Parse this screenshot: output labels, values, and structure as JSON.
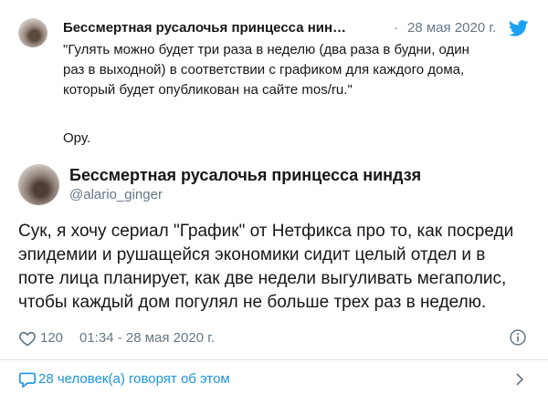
{
  "quoted": {
    "name": "Бессмертная русалочья принцесса нин…",
    "separator": "·",
    "date": "28 мая 2020 г.",
    "text": "\"Гулять можно будет три раза в неделю (два раза в будни, один\nраз в выходной) в соответствии с графиком для каждого дома,\nкоторый будет опубликован на сайте mos/ru.\"",
    "comment": "Ору."
  },
  "tweet": {
    "name": "Бессмертная русалочья принцесса ниндзя",
    "handle": "@alario_ginger",
    "body_lines": [
      "Сук, я хочу сериал \"График\" от Нетфикса про то, как посреди",
      "эпидемии и рушащейся экономики сидит целый отдел и в",
      "поте лица планирует, как две недели выгуливать мегаполис,",
      "чтобы каждый дом погулял не больше трех раз в неделю."
    ],
    "likes": "120",
    "timestamp": "01:34 - 28 мая 2020 г."
  },
  "footer": {
    "replies_label": "28 человек(а) говорят об этом"
  },
  "colors": {
    "twitter_blue": "#1da1f2",
    "link_blue": "#1b95e0",
    "muted": "#657786"
  },
  "icons": [
    "twitter-bird-icon",
    "heart-icon",
    "info-icon",
    "comment-bubble-icon",
    "chevron-right-icon"
  ]
}
